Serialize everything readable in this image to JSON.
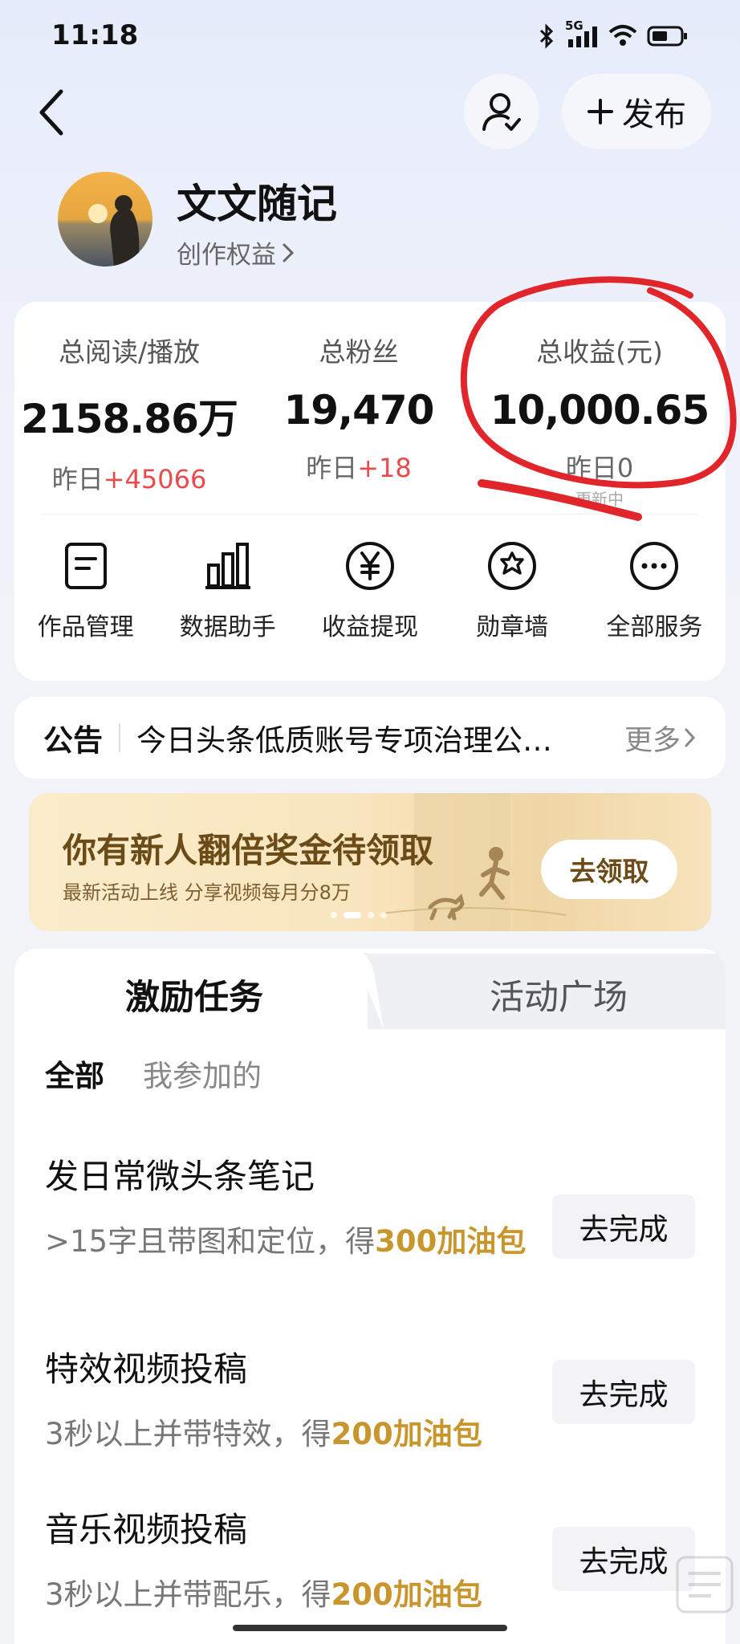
{
  "status_bar": {
    "time": "11:18",
    "network": "5G"
  },
  "header": {
    "publish_label": "发布"
  },
  "profile": {
    "name": "文文随记",
    "sub_link": "创作权益"
  },
  "stats": [
    {
      "label": "总阅读/播放",
      "value": "2158.86万",
      "yest_prefix": "昨日",
      "yest_value": "+45066"
    },
    {
      "label": "总粉丝",
      "value": "19,470",
      "yest_prefix": "昨日",
      "yest_value": "+18"
    },
    {
      "label": "总收益(元)",
      "value": "10,000.65",
      "yest_prefix": "昨日",
      "yest_value": "0",
      "note": "更新中"
    }
  ],
  "services": [
    {
      "label": "作品管理",
      "icon": "document-icon"
    },
    {
      "label": "数据助手",
      "icon": "bar-chart-icon"
    },
    {
      "label": "收益提现",
      "icon": "yuan-icon"
    },
    {
      "label": "勋章墙",
      "icon": "badge-icon"
    },
    {
      "label": "全部服务",
      "icon": "more-icon"
    }
  ],
  "notice": {
    "title": "公告",
    "text": "今日头条低质账号专项治理公…",
    "more": "更多"
  },
  "banner": {
    "title": "你有新人翻倍奖金待领取",
    "subtitle": "最新活动上线 分享视频每月分8万",
    "button": "去领取"
  },
  "tabs": {
    "active": "激励任务",
    "inactive": "活动广场"
  },
  "filters": {
    "all": "全部",
    "joined": "我参加的"
  },
  "tasks": [
    {
      "title": "发日常微头条笔记",
      "desc": ">15字且带图和定位，得",
      "reward": "300加油包",
      "button": "去完成"
    },
    {
      "title": "特效视频投稿",
      "desc": "3秒以上并带特效，得",
      "reward": "200加油包",
      "button": "去完成"
    },
    {
      "title": "音乐视频投稿",
      "desc": "3秒以上并带配乐，得",
      "reward": "200加油包",
      "button": "去完成"
    }
  ],
  "colors": {
    "accent_red": "#e84b4b",
    "reward_gold": "#c9962e",
    "annotation_red": "#e0252b"
  }
}
